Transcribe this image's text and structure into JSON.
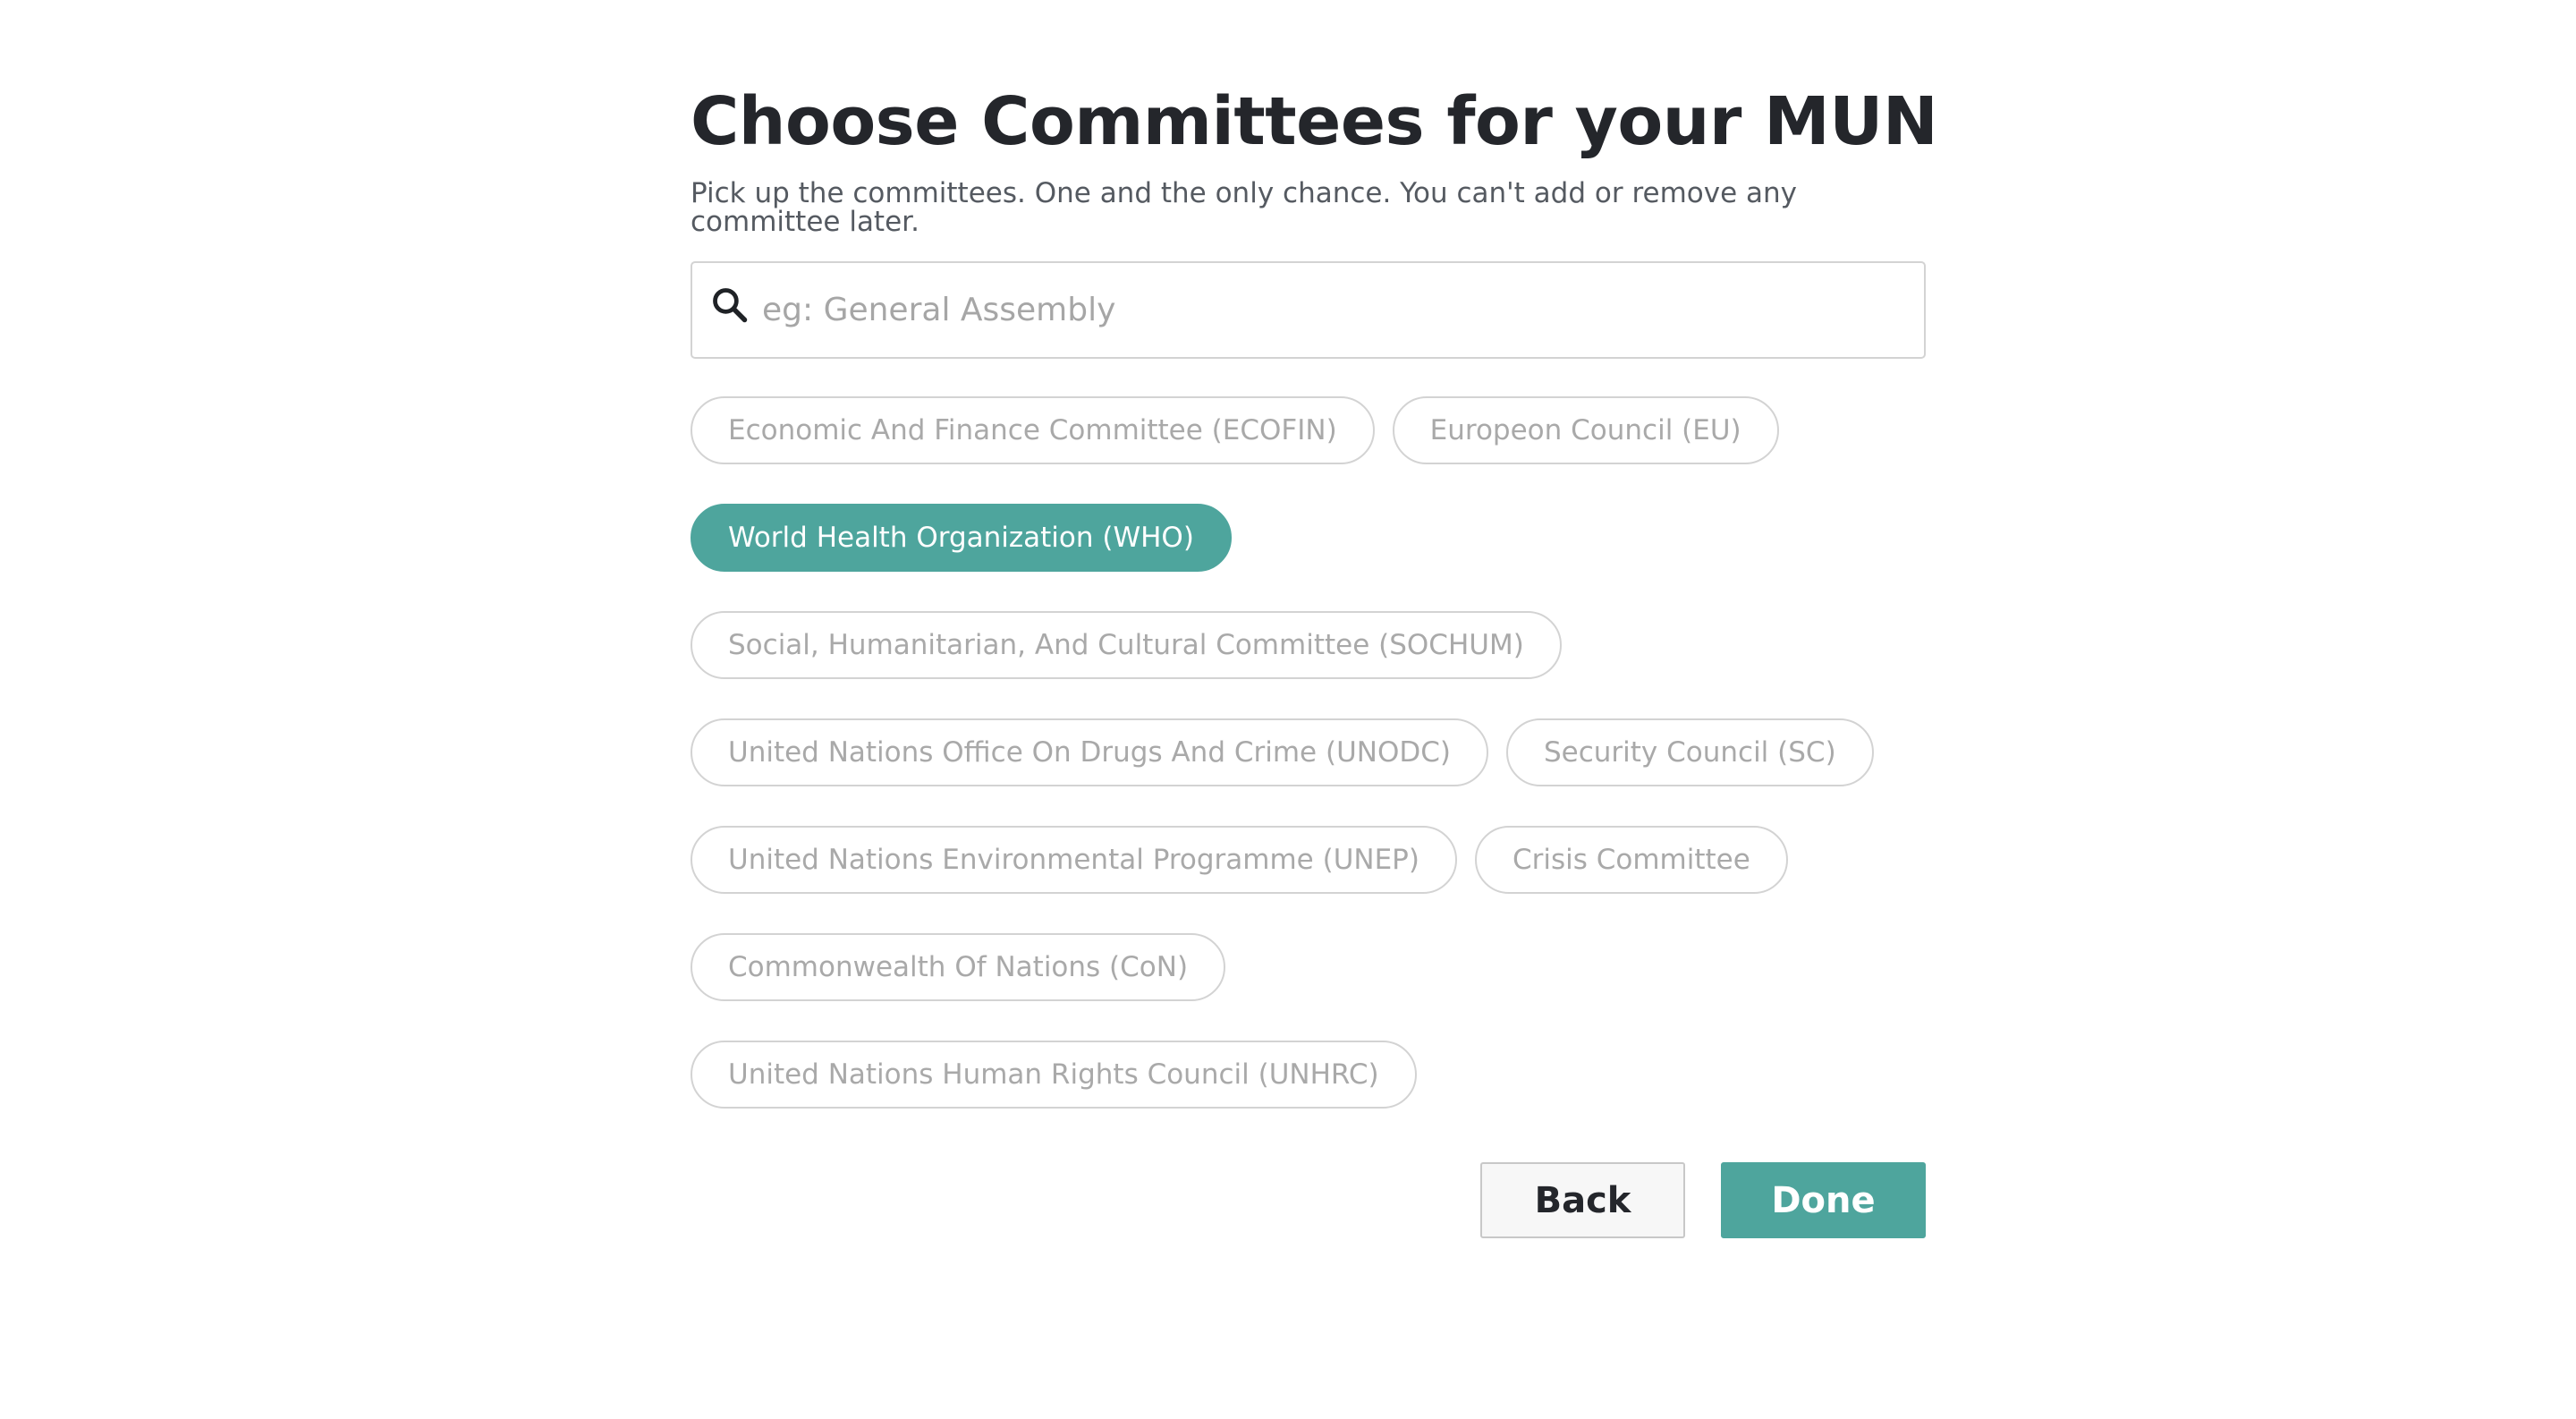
{
  "header": {
    "title": "Choose Committees for your MUN",
    "subtitle": "Pick up the committees. One and the only chance. You can't add or remove any committee later."
  },
  "search": {
    "placeholder": "eg: General Assembly",
    "value": "",
    "icon": "search-icon"
  },
  "committees": [
    {
      "label": "Economic And Finance Committee (ECOFIN)",
      "selected": false
    },
    {
      "label": "Europeon Council (EU)",
      "selected": false
    },
    {
      "label": "World Health Organization (WHO)",
      "selected": true
    },
    {
      "label": "Social, Humanitarian, And Cultural Committee (SOCHUM)",
      "selected": false
    },
    {
      "label": "United Nations Office On Drugs And Crime (UNODC)",
      "selected": false
    },
    {
      "label": "Security Council (SC)",
      "selected": false
    },
    {
      "label": "United Nations Environmental Programme (UNEP)",
      "selected": false
    },
    {
      "label": "Crisis Committee",
      "selected": false
    },
    {
      "label": "Commonwealth Of Nations (CoN)",
      "selected": false
    },
    {
      "label": "United Nations Human Rights Council (UNHRC)",
      "selected": false
    }
  ],
  "actions": {
    "back_label": "Back",
    "done_label": "Done"
  },
  "colors": {
    "accent": "#4ea59d",
    "chip_border": "#d3d3d3",
    "chip_text": "#a9a9a9",
    "title": "#24262b"
  }
}
